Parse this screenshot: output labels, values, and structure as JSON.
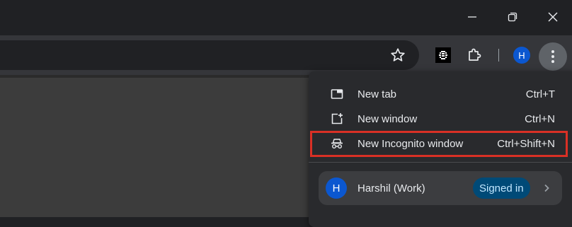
{
  "window_controls": {
    "minimize_icon": "minimize-icon",
    "restore_icon": "restore-icon",
    "close_icon": "close-icon"
  },
  "toolbar": {
    "bookmark_icon": "star-icon",
    "extension_icon": "qr-extension-icon",
    "extensions_menu_icon": "puzzle-icon",
    "profile_initial": "H",
    "menu_icon": "three-dot-menu-icon"
  },
  "menu": {
    "items": [
      {
        "label": "New tab",
        "shortcut": "Ctrl+T",
        "icon": "new-tab-icon"
      },
      {
        "label": "New window",
        "shortcut": "Ctrl+N",
        "icon": "new-window-icon"
      },
      {
        "label": "New Incognito window",
        "shortcut": "Ctrl+Shift+N",
        "icon": "incognito-icon"
      }
    ],
    "profile": {
      "initial": "H",
      "name": "Harshil (Work)",
      "status": "Signed in"
    }
  },
  "colors": {
    "accent": "#0b57d0",
    "highlight_border": "#d93025",
    "signed_in_badge": "#004a77"
  }
}
